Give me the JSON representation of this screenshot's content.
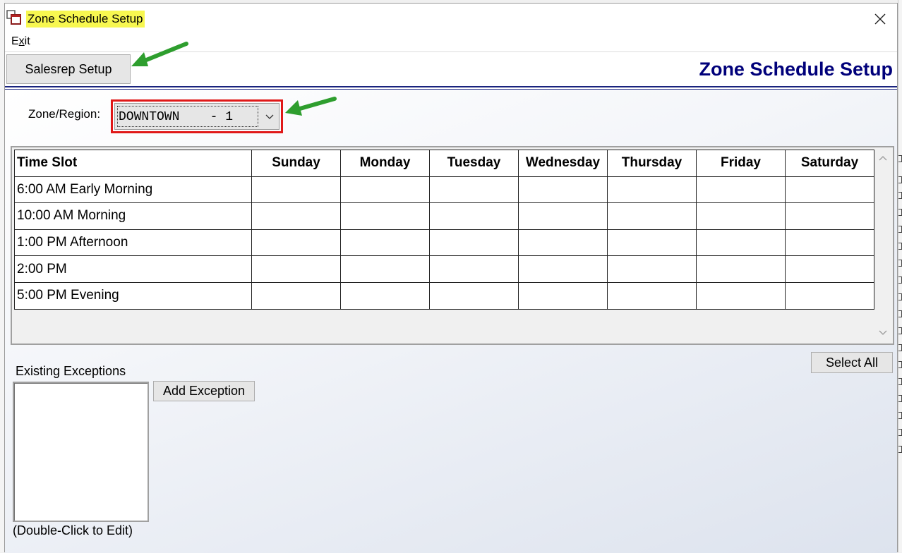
{
  "window": {
    "title": "Zone Schedule Setup",
    "title_highlight_color": "#f7f750"
  },
  "menu": {
    "exit_prefix": "E",
    "exit_access_key": "x",
    "exit_suffix": "it"
  },
  "header": {
    "salesrep_button": "Salesrep Setup",
    "page_title": "Zone Schedule Setup",
    "title_color": "#00007a"
  },
  "zone": {
    "label": "Zone/Region:",
    "selected": "DOWNTOWN    - 1"
  },
  "schedule": {
    "columns": [
      "Time Slot",
      "Sunday",
      "Monday",
      "Tuesday",
      "Wednesday",
      "Thursday",
      "Friday",
      "Saturday"
    ],
    "rows": [
      "6:00 AM Early Morning",
      "10:00 AM Morning",
      "1:00 PM Afternoon",
      "2:00 PM",
      "5:00 PM Evening"
    ]
  },
  "buttons": {
    "select_all": "Select All",
    "add_exception": "Add Exception"
  },
  "exceptions": {
    "label": "Existing Exceptions",
    "items": [],
    "hint": "(Double-Click to Edit)"
  },
  "annotations": {
    "highlight_color": "#e01818",
    "arrow_color": "#2e9e2e"
  }
}
